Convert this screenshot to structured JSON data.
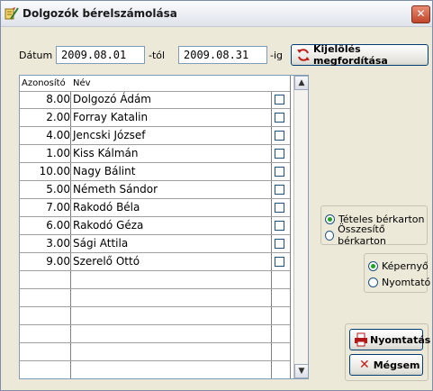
{
  "window": {
    "title": "Dolgozók bérelszámolása",
    "close": "✕"
  },
  "filter": {
    "date_label": "Dátum",
    "from_value": "2009.08.01",
    "from_suffix": "-tól",
    "to_value": "2009.08.31",
    "to_suffix": "-ig",
    "invert_button": "Kijelölés megfordítása"
  },
  "table": {
    "columns": [
      "Azonosító",
      "Név"
    ],
    "rows": [
      {
        "id": "8.00",
        "name": "Dolgozó Ádám",
        "checked": false
      },
      {
        "id": "2.00",
        "name": "Forray Katalin",
        "checked": false
      },
      {
        "id": "4.00",
        "name": "Jencski József",
        "checked": false
      },
      {
        "id": "1.00",
        "name": "Kiss Kálmán",
        "checked": false
      },
      {
        "id": "10.00",
        "name": "Nagy Bálint",
        "checked": false
      },
      {
        "id": "5.00",
        "name": "Németh Sándor",
        "checked": false
      },
      {
        "id": "7.00",
        "name": "Rakodó Béla",
        "checked": false
      },
      {
        "id": "6.00",
        "name": "Rakodó Géza",
        "checked": false
      },
      {
        "id": "3.00",
        "name": "Sági Attila",
        "checked": false
      },
      {
        "id": "9.00",
        "name": "Szerelő Ottó",
        "checked": false
      }
    ],
    "scroll_up": "▲",
    "scroll_down": "▼"
  },
  "report_type": {
    "options": [
      "Tételes bérkarton",
      "Összesítő bérkarton"
    ],
    "selected": "Tételes bérkarton"
  },
  "output": {
    "options": [
      "Képernyő",
      "Nyomtató"
    ],
    "selected": "Képernyő"
  },
  "actions": {
    "print": "Nyomtatás",
    "cancel": "Mégsem"
  },
  "colors": {
    "accent": "#21a121",
    "cancel_x": "#c0201c",
    "print_icon": "#b01818"
  }
}
